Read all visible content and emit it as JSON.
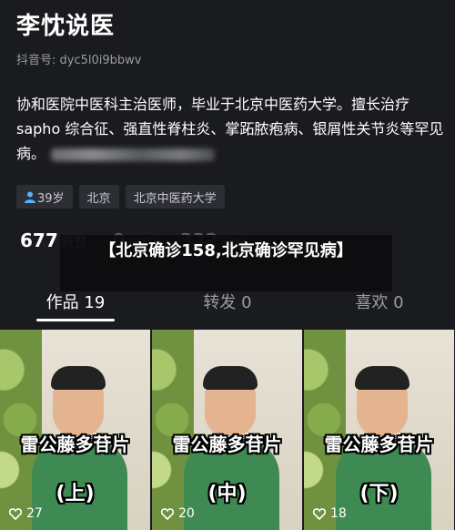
{
  "profile": {
    "name": "李忱说医",
    "douyin_id": "抖音号: dyc5l0i9bbwv",
    "bio": "协和医院中医科主治医师，毕业于北京中医药大学。擅长治疗 sapho 综合征、强直性脊柱炎、掌跖脓疱病、银屑性关节炎等罕见病。"
  },
  "tags": [
    {
      "icon": "person-icon",
      "label": "39岁"
    },
    {
      "label": "北京"
    },
    {
      "label": "北京中医药大学"
    }
  ],
  "stats": {
    "likes_count": "677",
    "likes_label": "获赞",
    "following_count": "9",
    "following_label": "关注",
    "fans_count": "322",
    "fans_label": "粉丝"
  },
  "overlay_title": "【北京确诊158,北京确诊罕见病】",
  "tabs": [
    {
      "label": "作品 19"
    },
    {
      "label": "转发 0"
    },
    {
      "label": "喜欢 0"
    }
  ],
  "videos": [
    {
      "title": "雷公藤多苷片",
      "subtitle": "(上)",
      "likes": "27"
    },
    {
      "title": "雷公藤多苷片",
      "subtitle": "(中)",
      "likes": "20"
    },
    {
      "title": "雷公藤多苷片",
      "subtitle": "(下)",
      "likes": "18"
    }
  ],
  "colors": {
    "background": "#1a1b1f",
    "tag_bg": "#2d2e34",
    "shirt_green": "#3f8a52",
    "text_muted": "#9a9ca3"
  }
}
